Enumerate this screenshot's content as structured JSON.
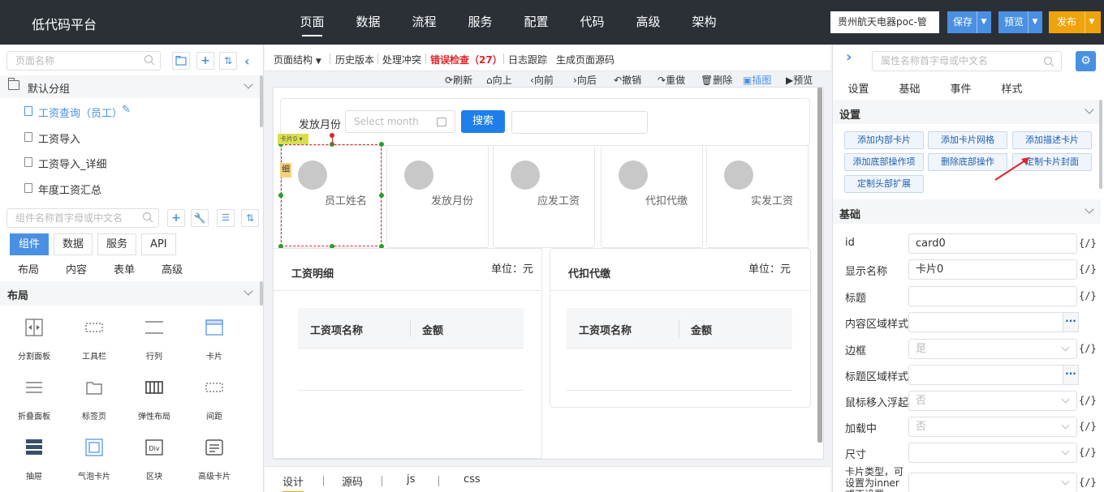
{
  "topbar": {
    "brand": "低代码平台",
    "nav": [
      "页面",
      "数据",
      "流程",
      "服务",
      "配置",
      "代码",
      "高级",
      "架构"
    ],
    "active_nav": "页面",
    "project": "贵州航天电器poc-管",
    "save": "保存",
    "preview": "预览",
    "publish": "发布"
  },
  "left": {
    "page_search_placeholder": "页面名称",
    "group": "默认分组",
    "pages": [
      "工资查询（员工）",
      "工资导入",
      "工资导入_详细",
      "年度工资汇总"
    ],
    "comp_search_placeholder": "组件名称首字母或中文名",
    "tabs": [
      "组件",
      "数据",
      "服务",
      "API"
    ],
    "subtabs": [
      "布局",
      "内容",
      "表单",
      "高级"
    ],
    "layout_section": "布局",
    "components": [
      "分割面板",
      "工具栏",
      "行列",
      "卡片",
      "折叠面板",
      "标签页",
      "弹性布局",
      "间距",
      "抽屉",
      "气泡卡片",
      "区块",
      "高级卡片"
    ]
  },
  "center": {
    "toolbar": {
      "structure": "页面结构",
      "history": "历史版本",
      "conflict": "处理冲突",
      "errors": "错误检查（27）",
      "log": "日志跟踪",
      "source": "生成页面源码"
    },
    "actions": [
      "刷新",
      "向上",
      "向前",
      "向后",
      "撤销",
      "重做",
      "删除",
      "插图",
      "预览"
    ],
    "filter": {
      "label": "发放月份",
      "month_placeholder": "Select month",
      "search": "搜索"
    },
    "card_tag": "卡片0",
    "side_tag": "细",
    "summary_cards": [
      "员工姓名",
      "发放月份",
      "应发工资",
      "代扣代缴",
      "实发工资"
    ],
    "detail_left": {
      "title": "工资明细",
      "unit": "单位：元",
      "col1": "工资项名称",
      "col2": "金额"
    },
    "detail_right": {
      "title": "代扣代缴",
      "unit": "单位：元",
      "col1": "工资项名称",
      "col2": "金额"
    },
    "bottom_tabs": [
      "设计",
      "源码",
      "js",
      "css"
    ]
  },
  "right": {
    "search_placeholder": "属性名称首字母或中文名",
    "tabs": [
      "设置",
      "基础",
      "事件",
      "样式"
    ],
    "settings_title": "设置",
    "action_buttons": [
      "添加内部卡片",
      "添加卡片网格",
      "添加描述卡片",
      "添加底部操作项",
      "删除底部操作",
      "定制卡片封面",
      "定制头部扩展"
    ],
    "base_title": "基础",
    "props": {
      "id_label": "id",
      "id_value": "card0",
      "name_label": "显示名称",
      "name_value": "卡片0",
      "title_label": "标题",
      "content_style_label": "内容区域样式",
      "border_label": "边框",
      "border_value": "是",
      "title_style_label": "标题区域样式",
      "hover_label": "鼠标移入浮起",
      "hover_value": "否",
      "loading_label": "加载中",
      "loading_value": "否",
      "size_label": "尺寸",
      "type_label": "卡片类型，可设置为inner或不设置"
    },
    "expr": "{/}"
  }
}
